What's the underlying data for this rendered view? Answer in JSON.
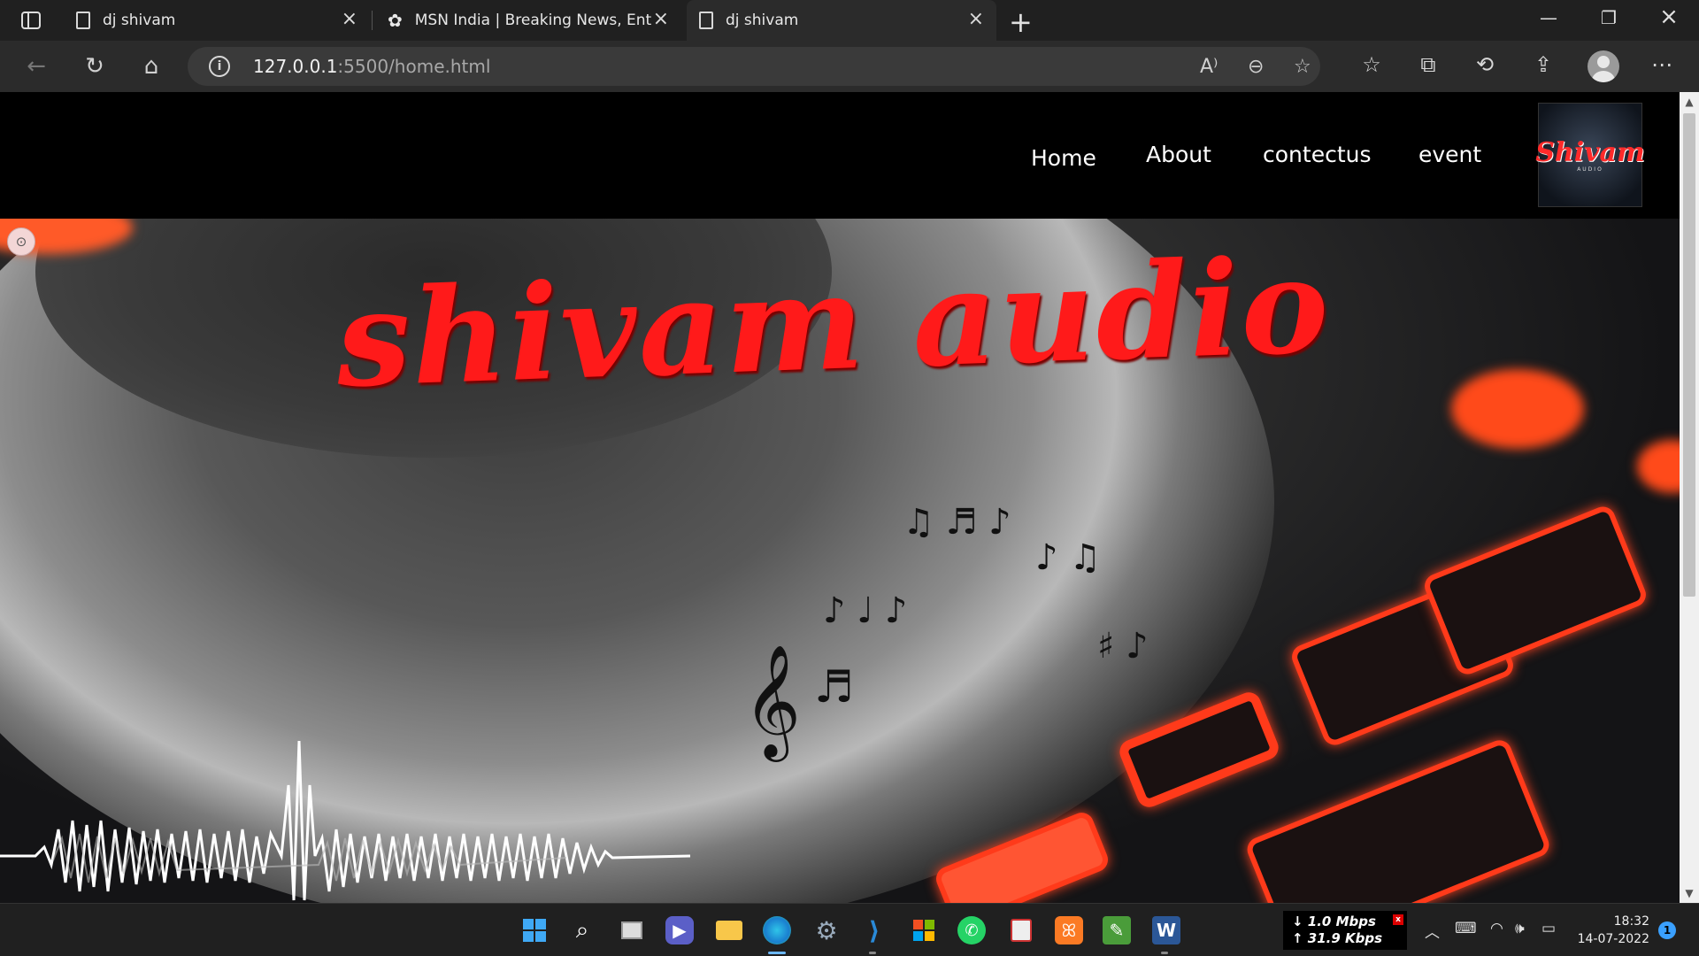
{
  "browser": {
    "tabs": [
      {
        "title": "dj shivam",
        "active": false
      },
      {
        "title": "MSN India | Breaking News, Ente",
        "active": false
      },
      {
        "title": "dj shivam",
        "active": true
      }
    ],
    "url_host": "127.0.0.1",
    "url_rest": ":5500/home.html"
  },
  "site": {
    "nav": {
      "home": "Home",
      "about": "About",
      "contact": "contectus",
      "event": "event"
    },
    "logo_text": "Shivam",
    "logo_sub": "AUDIO",
    "hero_title": "shivam audio",
    "accent_color": "#ff1a1a"
  },
  "taskbar": {
    "net_down": "1.0 Mbps",
    "net_up": "31.9 Kbps",
    "time": "18:32",
    "date": "14-07-2022",
    "notification_count": "1"
  }
}
